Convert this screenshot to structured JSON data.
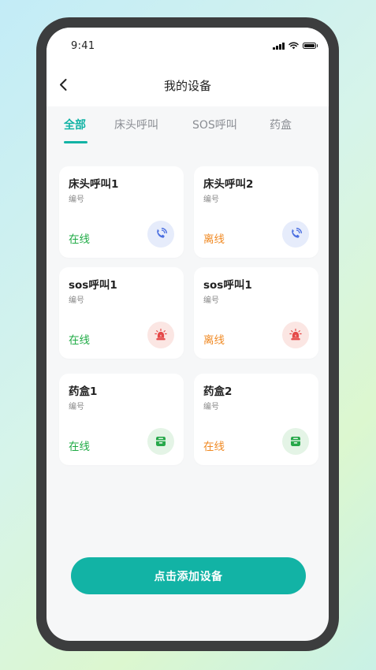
{
  "status_bar": {
    "time": "9:41"
  },
  "header": {
    "title": "我的设备"
  },
  "tabs": [
    {
      "label": "全部",
      "active": true
    },
    {
      "label": "床头呼叫",
      "active": false
    },
    {
      "label": "SOS呼叫",
      "active": false
    },
    {
      "label": "药盒",
      "active": false
    }
  ],
  "devices": [
    {
      "name": "床头呼叫1",
      "sub": "编号",
      "status": "在线",
      "status_color": "#1fab45",
      "icon": "phone-call-icon",
      "icon_color": "#4a6ee0",
      "icon_bg": "#e6ecfb"
    },
    {
      "name": "床头呼叫2",
      "sub": "编号",
      "status": "离线",
      "status_color": "#f08a24",
      "icon": "phone-call-icon",
      "icon_color": "#4a6ee0",
      "icon_bg": "#e6ecfb"
    },
    {
      "name": "sos呼叫1",
      "sub": "编号",
      "status": "在线",
      "status_color": "#1fab45",
      "icon": "alarm-siren-icon",
      "icon_color": "#e54848",
      "icon_bg": "#fbe6e3"
    },
    {
      "name": "sos呼叫1",
      "sub": "编号",
      "status": "离线",
      "status_color": "#f08a24",
      "icon": "alarm-siren-icon",
      "icon_color": "#e54848",
      "icon_bg": "#fbe6e3"
    },
    {
      "name": "药盒1",
      "sub": "编号",
      "status": "在线",
      "status_color": "#1fab45",
      "icon": "pill-box-icon",
      "icon_color": "#27a84a",
      "icon_bg": "#e4f4e6"
    },
    {
      "name": "药盒2",
      "sub": "编号",
      "status": "在线",
      "status_color": "#f08a24",
      "icon": "pill-box-icon",
      "icon_color": "#27a84a",
      "icon_bg": "#e4f4e6"
    }
  ],
  "add_button": {
    "label": "点击添加设备"
  },
  "colors": {
    "accent": "#12b3a5",
    "online": "#1fab45",
    "offline": "#f08a24"
  }
}
